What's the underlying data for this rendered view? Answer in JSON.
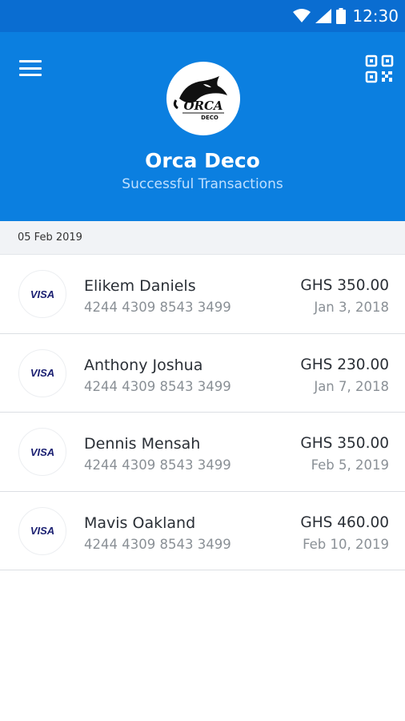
{
  "status_bar": {
    "time": "12:30",
    "icons": [
      "wifi-icon",
      "signal-icon",
      "battery-icon"
    ]
  },
  "header": {
    "menu_icon": "hamburger-menu-icon",
    "qr_icon": "qr-code-icon",
    "logo_text_top": "ORCA",
    "logo_text_bottom": "DECO",
    "brand_name": "Orca Deco",
    "subtitle": "Successful Transactions"
  },
  "date_section": {
    "label": "05 Feb 2019"
  },
  "transactions": [
    {
      "card_brand": "VISA",
      "name": "Elikem Daniels",
      "card_number": "4244 4309 8543 3499",
      "amount": "GHS 350.00",
      "date": "Jan 3, 2018"
    },
    {
      "card_brand": "VISA",
      "name": "Anthony Joshua",
      "card_number": "4244 4309 8543 3499",
      "amount": "GHS 230.00",
      "date": "Jan 7, 2018"
    },
    {
      "card_brand": "VISA",
      "name": "Dennis Mensah",
      "card_number": "4244 4309 8543 3499",
      "amount": "GHS 350.00",
      "date": "Feb 5, 2019"
    },
    {
      "card_brand": "VISA",
      "name": "Mavis Oakland",
      "card_number": "4244 4309 8543 3499",
      "amount": "GHS 460.00",
      "date": "Feb 10, 2019"
    }
  ],
  "colors": {
    "header_bg": "#0b7fe0",
    "status_bar_bg": "#0a6dd1",
    "visa_blue": "#1a1f71"
  }
}
